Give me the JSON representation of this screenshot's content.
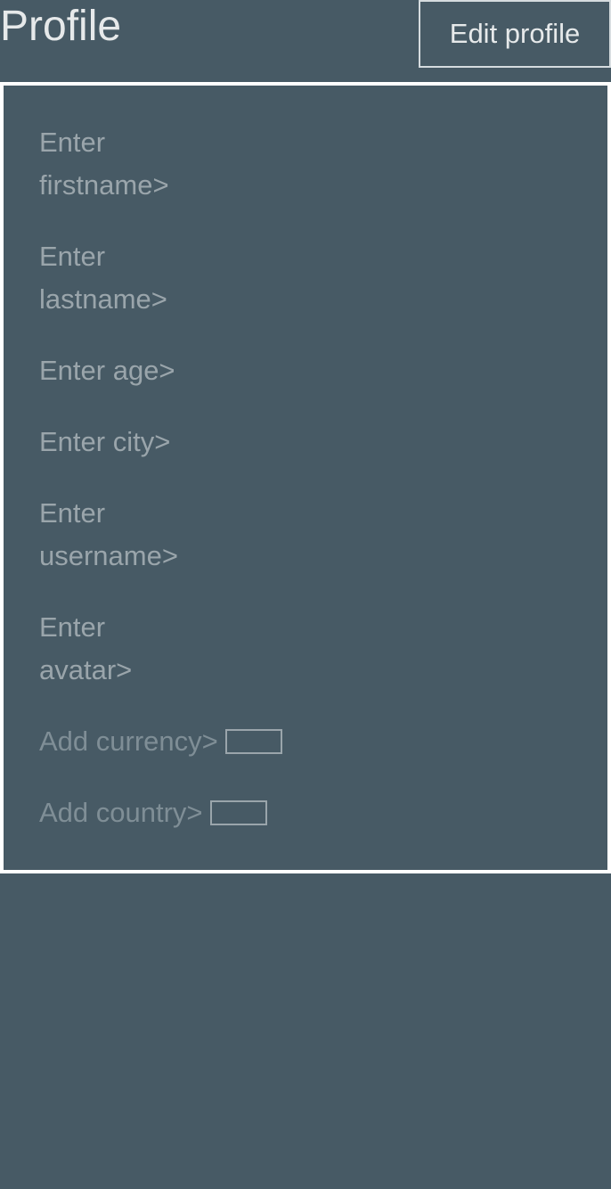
{
  "header": {
    "title": "Profile",
    "edit_button_label": "Edit profile"
  },
  "form": {
    "firstname_placeholder": "Enter firstname>",
    "lastname_placeholder": "Enter lastname>",
    "age_placeholder": "Enter age>",
    "city_placeholder": "Enter city>",
    "username_placeholder": "Enter username>",
    "avatar_placeholder": "Enter avatar>",
    "currency_label": "Add currency>",
    "country_label": "Add country>"
  },
  "colors": {
    "background": "#475a65",
    "panel_border": "#ffffff",
    "placeholder_text": "#9aa5ab",
    "title_text": "#e6e9ea"
  }
}
